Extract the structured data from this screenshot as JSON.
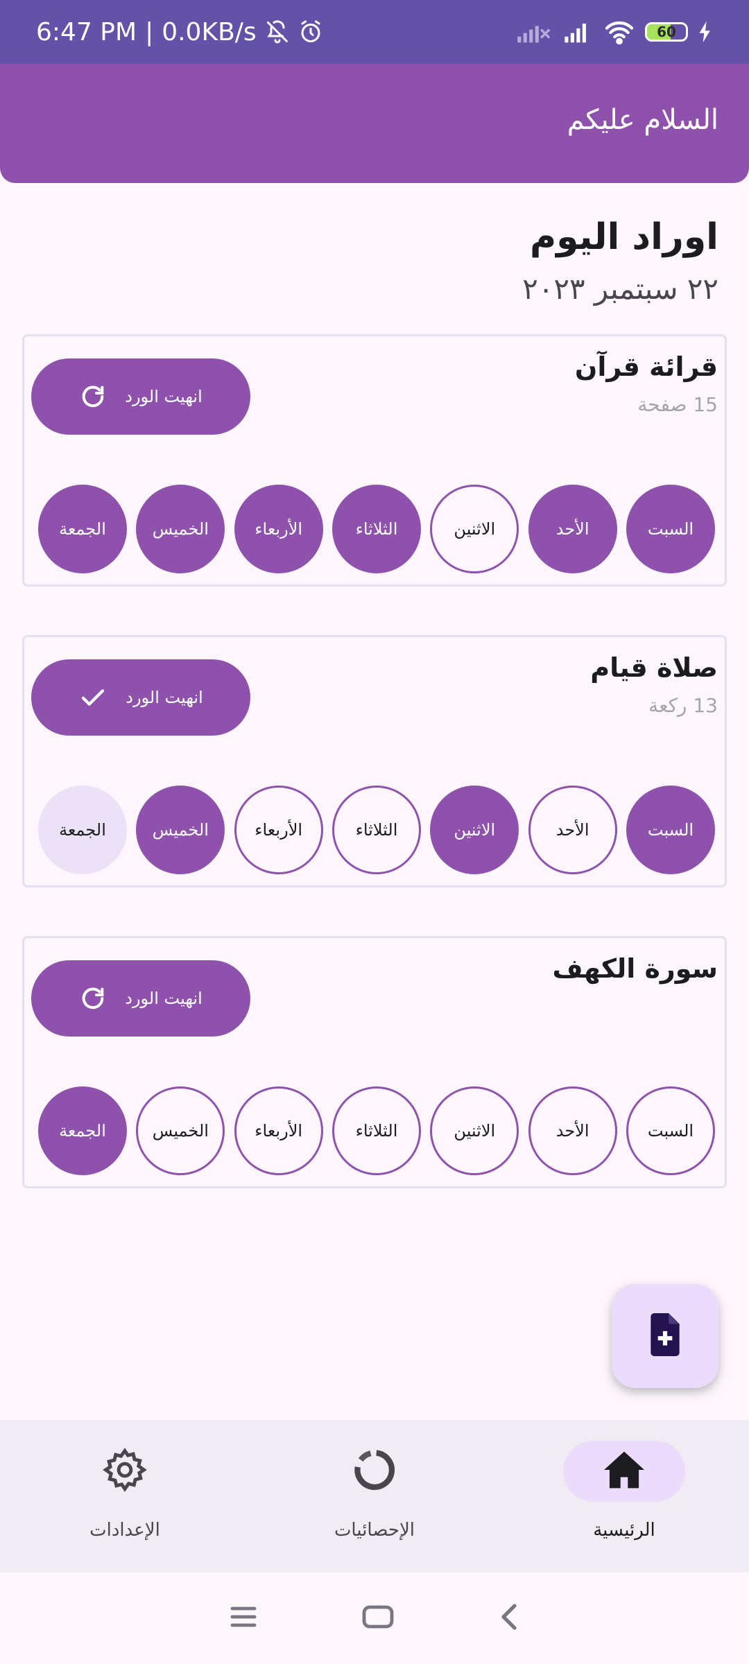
{
  "status_bar": {
    "time": "6:47 PM",
    "separator": "|",
    "speed": "0.0KB/s",
    "battery_percent": "60",
    "battery_level": 0.6,
    "icons": [
      "bell-off-icon",
      "alarm-icon",
      "signal-x-icon",
      "signal-icon",
      "wifi-icon",
      "battery-icon",
      "charging-icon"
    ]
  },
  "header": {
    "title": "السلام عليكم"
  },
  "section": {
    "title": "اوراد اليوم",
    "date": "٢٢ سبتمبر ٢٠٢٣"
  },
  "cards": [
    {
      "title": "قرائة قرآن",
      "subtitle": "15 صفحة",
      "button_label": "انهيت الورد",
      "button_icon": "refresh-icon",
      "days": [
        {
          "label": "السبت",
          "state": "filled"
        },
        {
          "label": "الأحد",
          "state": "filled"
        },
        {
          "label": "الاثنين",
          "state": "outline"
        },
        {
          "label": "الثلاثاء",
          "state": "filled"
        },
        {
          "label": "الأربعاء",
          "state": "filled"
        },
        {
          "label": "الخميس",
          "state": "filled"
        },
        {
          "label": "الجمعة",
          "state": "filled"
        }
      ]
    },
    {
      "title": "صلاة قيام",
      "subtitle": "13 ركعة",
      "button_label": "انهيت الورد",
      "button_icon": "check-icon",
      "days": [
        {
          "label": "السبت",
          "state": "filled"
        },
        {
          "label": "الأحد",
          "state": "outline"
        },
        {
          "label": "الاثنين",
          "state": "filled"
        },
        {
          "label": "الثلاثاء",
          "state": "outline"
        },
        {
          "label": "الأربعاء",
          "state": "outline"
        },
        {
          "label": "الخميس",
          "state": "filled"
        },
        {
          "label": "الجمعة",
          "state": "light"
        }
      ]
    },
    {
      "title": "سورة الكهف",
      "subtitle": "",
      "button_label": "انهيت الورد",
      "button_icon": "refresh-icon",
      "days": [
        {
          "label": "السبت",
          "state": "outline"
        },
        {
          "label": "الأحد",
          "state": "outline"
        },
        {
          "label": "الاثنين",
          "state": "outline"
        },
        {
          "label": "الثلاثاء",
          "state": "outline"
        },
        {
          "label": "الأربعاء",
          "state": "outline"
        },
        {
          "label": "الخميس",
          "state": "outline"
        },
        {
          "label": "الجمعة",
          "state": "filled"
        }
      ]
    }
  ],
  "fab": {
    "icon": "add-document-icon"
  },
  "bottom_nav": [
    {
      "label": "الرئيسية",
      "icon": "home-icon",
      "active": true
    },
    {
      "label": "الإحصائيات",
      "icon": "stats-ring-icon",
      "active": false
    },
    {
      "label": "الإعدادات",
      "icon": "gear-icon",
      "active": false
    }
  ],
  "system_nav": {
    "icons": [
      "menu-icon",
      "home-square-icon",
      "back-icon"
    ]
  },
  "colors": {
    "primary": "#8e52ac",
    "status_bar": "#6452a8",
    "light_accent": "#ece2f8",
    "background": "#fdf7fd"
  }
}
